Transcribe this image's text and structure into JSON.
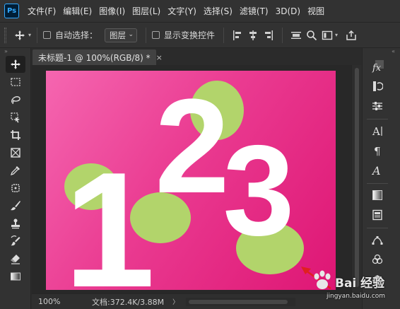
{
  "menu": {
    "logo": "Ps",
    "items": [
      "文件(F)",
      "编辑(E)",
      "图像(I)",
      "图层(L)",
      "文字(Y)",
      "选择(S)",
      "滤镜(T)",
      "3D(D)",
      "视图"
    ]
  },
  "options": {
    "auto_select_label": "自动选择：",
    "auto_select_target": "图层",
    "show_transform_label": "显示变换控件"
  },
  "document": {
    "tab_title": "未标题-1 @ 100%(RGB/8) *",
    "close": "×"
  },
  "canvas": {
    "background_start": "#f566b0",
    "background_end": "#de1674",
    "circle_color": "#b2d46b",
    "digit_color": "#ffffff",
    "digits": [
      "1",
      "2",
      "3"
    ]
  },
  "status": {
    "zoom": "100%",
    "doc_info": "文档:372.4K/3.88M",
    "arrow": "〉"
  },
  "watermark": {
    "main": "Bai 经验",
    "url": "jingyan.baidu.com"
  },
  "colors": {
    "annotation_arrow": "#e0201f",
    "ps_logo_border": "#31a8ff"
  }
}
